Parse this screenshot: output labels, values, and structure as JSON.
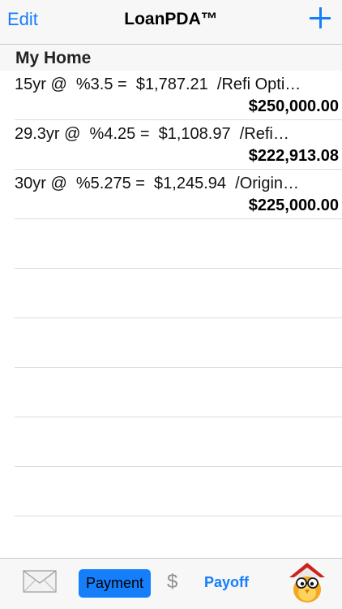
{
  "navbar": {
    "edit_label": "Edit",
    "title": "LoanPDA™",
    "add_icon": "plus-icon"
  },
  "section": {
    "title": "My Home"
  },
  "loans": [
    {
      "summary": "15yr @  %3.5 =  $1,787.21  /Refi Opti…",
      "amount": "$250,000.00"
    },
    {
      "summary": "29.3yr @  %4.25 =  $1,108.97  /Refi…",
      "amount": "$222,913.08"
    },
    {
      "summary": "30yr @  %5.275 =  $1,245.94  /Origin…",
      "amount": "$225,000.00"
    }
  ],
  "toolbar": {
    "mail_icon": "envelope-icon",
    "payment_label": "Payment",
    "dollar_symbol": "$",
    "payoff_label": "Payoff",
    "app_icon": "house-mascot-icon"
  },
  "colors": {
    "accent": "#157efb",
    "bar_background": "#f7f7f7",
    "separator": "#dcdcdf"
  }
}
